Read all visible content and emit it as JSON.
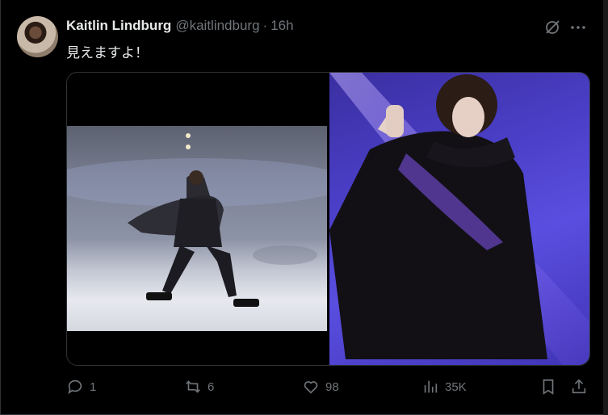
{
  "tweet": {
    "author_name": "Kaitlin Lindburg",
    "handle": "@kaitlindburg",
    "separator": "·",
    "time": "16h",
    "text": "見えますよ！"
  },
  "media": {
    "images": [
      {
        "name": "skater-on-ice"
      },
      {
        "name": "skater-purple-light"
      }
    ]
  },
  "actions": {
    "replies": "1",
    "reposts": "6",
    "likes": "98",
    "views": "35K"
  },
  "icons": {
    "header": [
      "grok-icon",
      "more-icon"
    ],
    "actions": [
      "reply-icon",
      "repost-icon",
      "like-icon",
      "views-icon",
      "bookmark-icon",
      "share-icon"
    ]
  },
  "colors": {
    "background": "#000000",
    "text": "#e7e9ea",
    "muted": "#71767b",
    "border": "#2f3336"
  }
}
